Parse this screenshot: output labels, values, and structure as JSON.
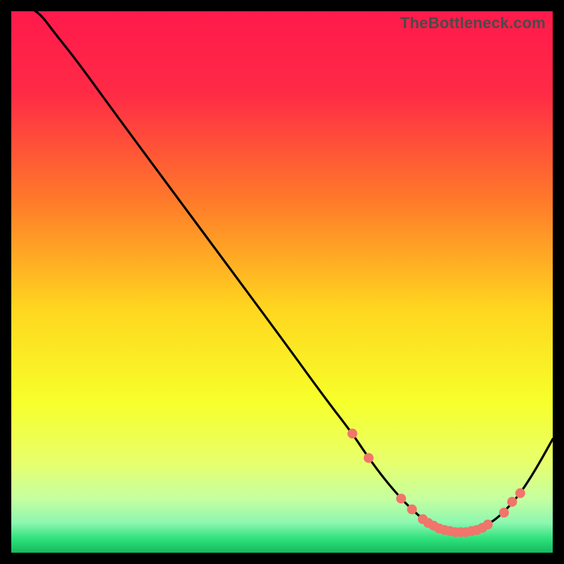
{
  "watermark": "TheBottleneck.com",
  "chart_data": {
    "type": "line",
    "title": "",
    "xlabel": "",
    "ylabel": "",
    "xlim": [
      0,
      100
    ],
    "ylim": [
      0,
      100
    ],
    "gradient_stops": [
      {
        "offset": 0.0,
        "color": "#ff1a4b"
      },
      {
        "offset": 0.15,
        "color": "#ff2a46"
      },
      {
        "offset": 0.35,
        "color": "#ff7a2a"
      },
      {
        "offset": 0.55,
        "color": "#ffd61f"
      },
      {
        "offset": 0.72,
        "color": "#f7ff2a"
      },
      {
        "offset": 0.83,
        "color": "#e8ff6a"
      },
      {
        "offset": 0.9,
        "color": "#c6ffa0"
      },
      {
        "offset": 0.945,
        "color": "#8cf7b0"
      },
      {
        "offset": 0.975,
        "color": "#2de07a"
      },
      {
        "offset": 1.0,
        "color": "#17b85f"
      }
    ],
    "series": [
      {
        "name": "curve",
        "x": [
          0,
          2,
          5,
          8,
          12,
          20,
          30,
          40,
          50,
          58,
          63,
          66,
          69,
          72,
          74,
          76,
          78,
          80,
          82,
          84,
          86,
          88,
          90,
          92,
          94,
          96,
          98,
          100
        ],
        "y": [
          101,
          101,
          100,
          96,
          91,
          80,
          66.5,
          53,
          39.5,
          28.5,
          22,
          17.5,
          13.5,
          10,
          8,
          6.2,
          5,
          4.2,
          3.8,
          3.8,
          4.2,
          5.2,
          6.6,
          8.6,
          11,
          14,
          17.4,
          21
        ]
      }
    ],
    "markers": {
      "color": "#f0756a",
      "radius": 7,
      "points": [
        {
          "x": 63,
          "y": 22
        },
        {
          "x": 66,
          "y": 17.5
        },
        {
          "x": 72,
          "y": 10
        },
        {
          "x": 74,
          "y": 8
        },
        {
          "x": 76,
          "y": 6.2
        },
        {
          "x": 77,
          "y": 5.5
        },
        {
          "x": 78,
          "y": 5
        },
        {
          "x": 79,
          "y": 4.5
        },
        {
          "x": 80,
          "y": 4.2
        },
        {
          "x": 81,
          "y": 4
        },
        {
          "x": 82,
          "y": 3.8
        },
        {
          "x": 83,
          "y": 3.8
        },
        {
          "x": 84,
          "y": 3.8
        },
        {
          "x": 85,
          "y": 4
        },
        {
          "x": 86,
          "y": 4.2
        },
        {
          "x": 87,
          "y": 4.6
        },
        {
          "x": 88,
          "y": 5.2
        },
        {
          "x": 91,
          "y": 7.4
        },
        {
          "x": 92.5,
          "y": 9.4
        },
        {
          "x": 94,
          "y": 11
        }
      ]
    }
  }
}
